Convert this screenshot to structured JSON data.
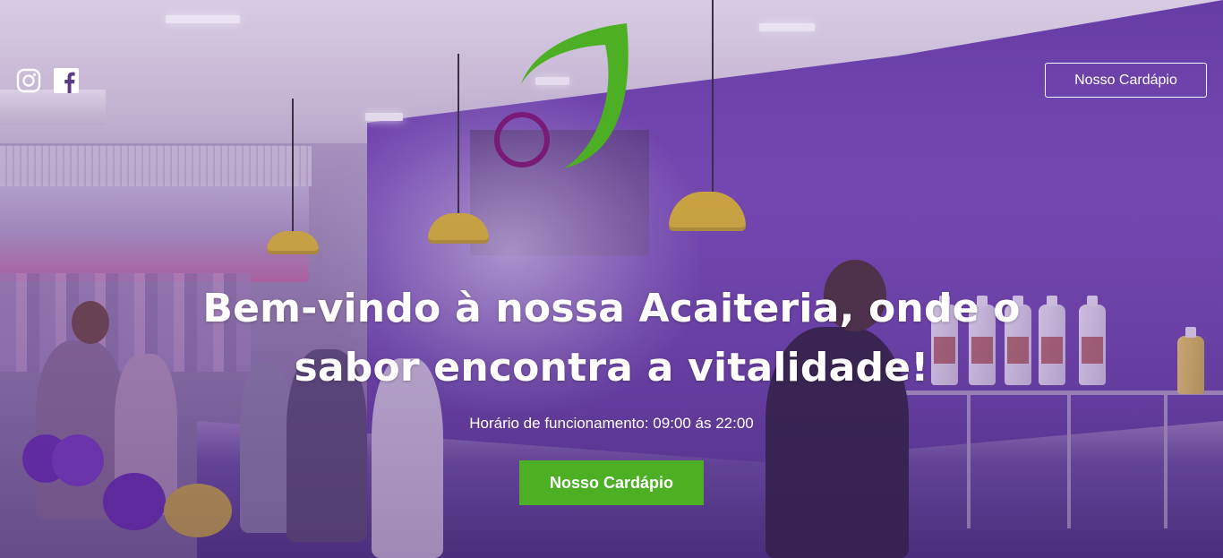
{
  "social": {
    "instagram_icon": "instagram-icon",
    "facebook_icon": "facebook-icon"
  },
  "logo": {
    "icon": "acai-leaf-logo",
    "leaf_color": "#4caf24",
    "berry_color": "#7a1a78"
  },
  "header": {
    "cta_label": "Nosso Cardápio"
  },
  "hero": {
    "headline_line1": "Bem-vindo à nossa Acaiteria, onde o",
    "headline_line2": "sabor encontra a vitalidade!",
    "hours_text": "Horário de funcionamento: 09:00 ás 22:00",
    "cta_label": "Nosso Cardápio",
    "cta_color": "#4caf24",
    "overlay_color": "#5a3a86"
  }
}
